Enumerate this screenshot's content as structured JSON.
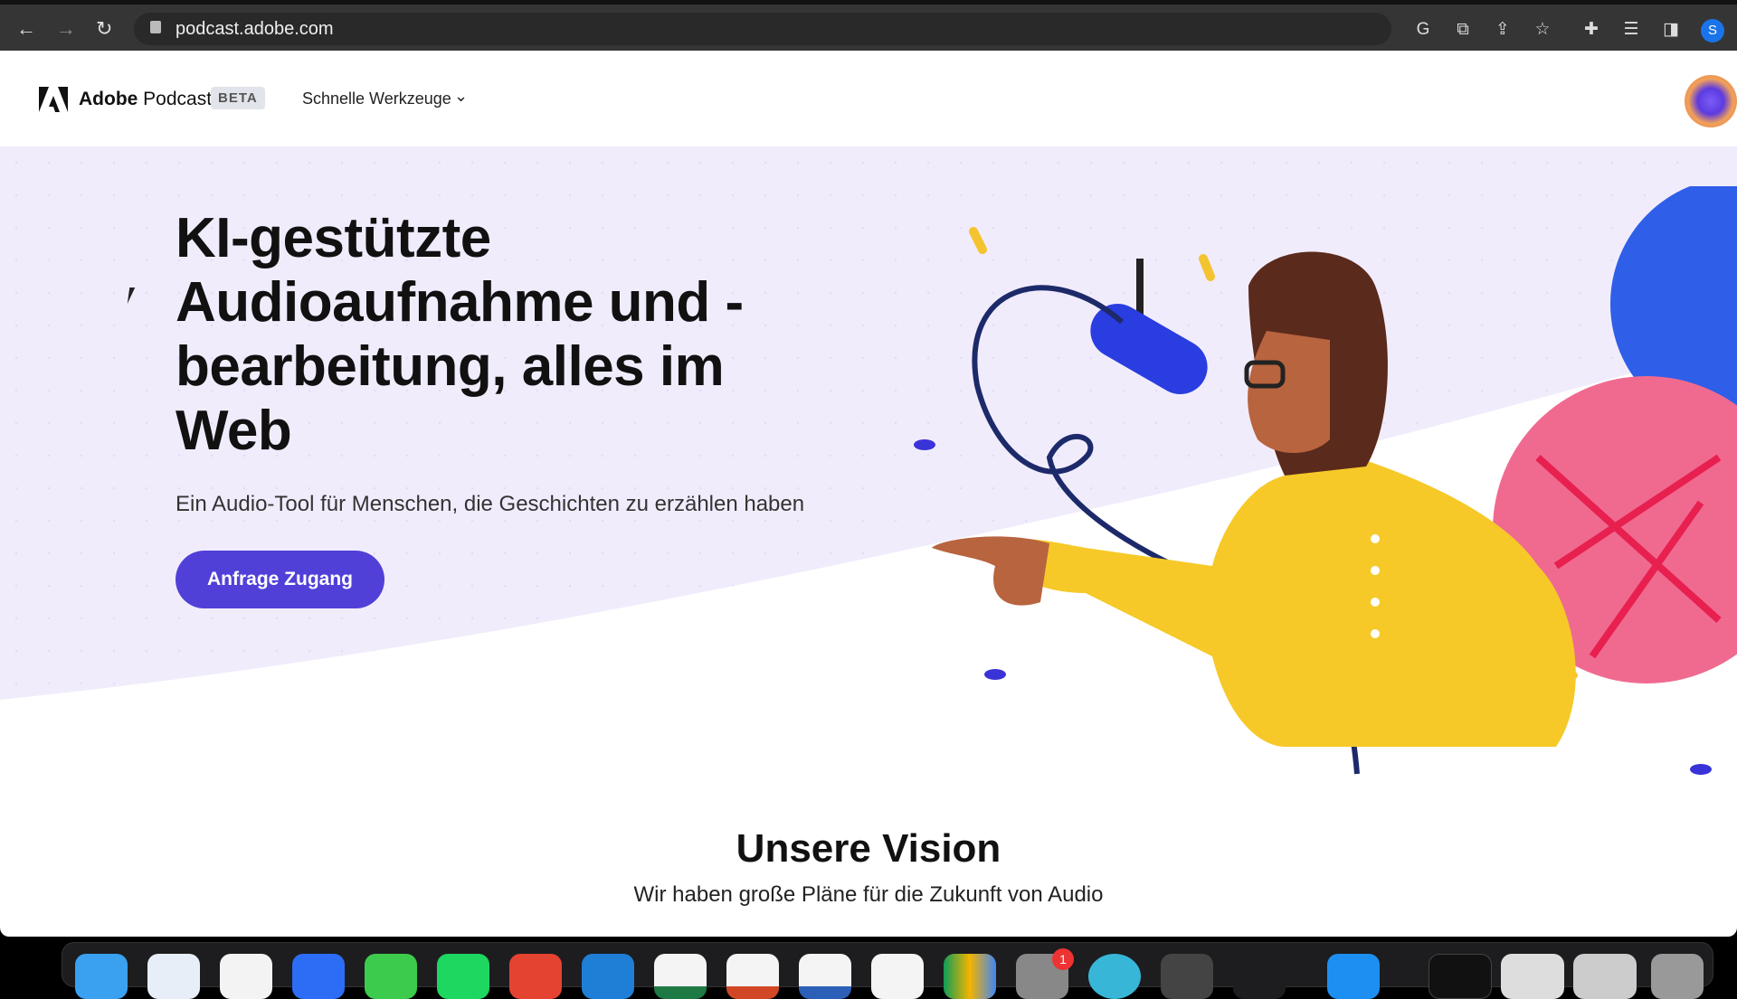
{
  "browser": {
    "url": "podcast.adobe.com",
    "profile_initial": "S",
    "nav": {
      "back": "←",
      "forward": "→",
      "reload": "↻"
    },
    "extensions": [
      "google-icon",
      "translate-icon",
      "share-icon",
      "star-icon",
      "puzzle-icon",
      "reading-list-icon",
      "sidepanel-icon"
    ]
  },
  "header": {
    "brand_bold": "Adobe",
    "brand_rest": " Podcast",
    "badge": "BETA",
    "menu_label": "Schnelle Werkzeuge"
  },
  "hero": {
    "headline": "KI-gestützte Audioaufnahme und -bearbeitung, alles im Web",
    "subtitle": "Ein Audio-Tool für Menschen, die Geschichten zu erzählen haben",
    "cta": "Anfrage Zugang",
    "accent": "#5140d8",
    "background": "#f1ecfc"
  },
  "vision": {
    "title": "Unsere Vision",
    "subtitle": "Wir haben große Pläne für die Zukunft von Audio"
  },
  "dock": {
    "apps": [
      "finder",
      "safari",
      "chrome",
      "zoom",
      "whatsapp",
      "spotify",
      "todoist",
      "trello",
      "excel",
      "powerpoint",
      "word",
      "imovie",
      "google-drive",
      "system-preferences",
      "maps",
      "quicktime",
      "soundwave",
      "xcode",
      "window-1",
      "window-2",
      "window-3",
      "trash"
    ],
    "badge": "1"
  }
}
